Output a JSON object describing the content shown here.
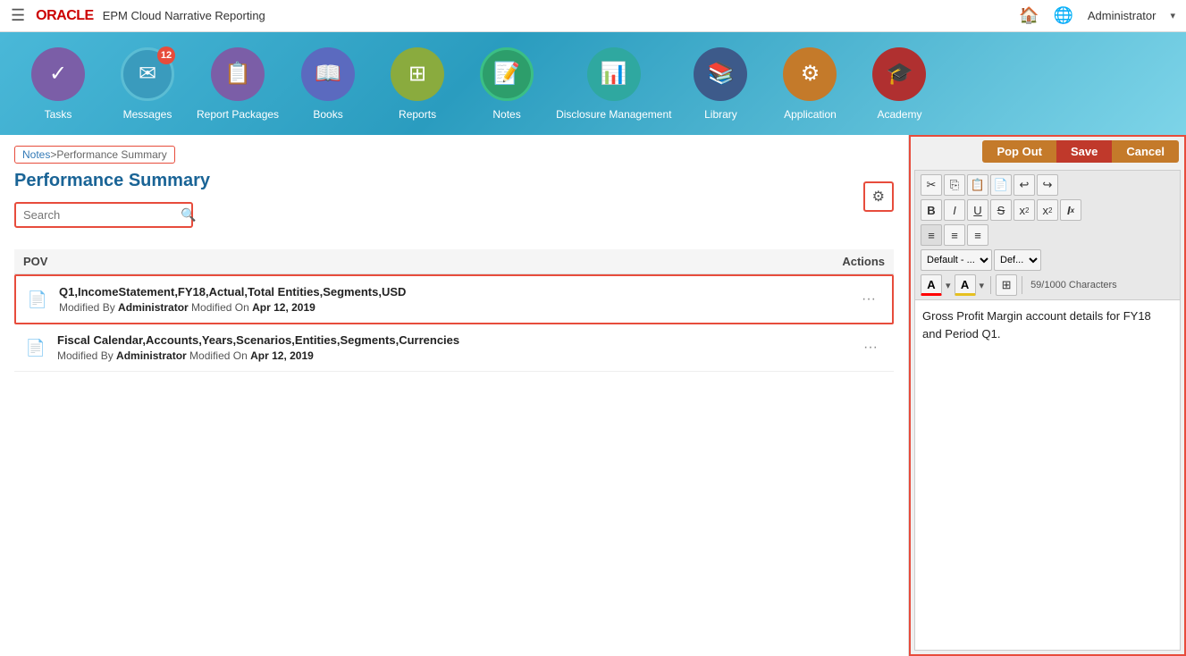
{
  "app": {
    "title": "EPM Cloud Narrative Reporting",
    "user": "Administrator"
  },
  "nav": {
    "items": [
      {
        "id": "tasks",
        "label": "Tasks",
        "icon": "✓",
        "circle": "circle-purple",
        "badge": null
      },
      {
        "id": "messages",
        "label": "Messages",
        "icon": "✉",
        "circle": "circle-teal",
        "badge": "12"
      },
      {
        "id": "report-packages",
        "label": "Report Packages",
        "icon": "📋",
        "circle": "circle-purple2",
        "badge": null
      },
      {
        "id": "books",
        "label": "Books",
        "icon": "📖",
        "circle": "circle-indigo",
        "badge": null
      },
      {
        "id": "reports",
        "label": "Reports",
        "icon": "⊞",
        "circle": "circle-olive",
        "badge": null
      },
      {
        "id": "notes",
        "label": "Notes",
        "icon": "📝",
        "circle": "circle-green",
        "badge": null
      },
      {
        "id": "disclosure",
        "label": "Disclosure Management",
        "icon": "📊",
        "circle": "circle-teal2",
        "badge": null
      },
      {
        "id": "library",
        "label": "Library",
        "icon": "📚",
        "circle": "circle-navy",
        "badge": null
      },
      {
        "id": "application",
        "label": "Application",
        "icon": "⚙",
        "circle": "circle-brown",
        "badge": null
      },
      {
        "id": "academy",
        "label": "Academy",
        "icon": "🎓",
        "circle": "circle-red",
        "badge": null
      }
    ]
  },
  "breadcrumb": {
    "parent": "Notes",
    "separator": " > ",
    "current": "Performance Summary"
  },
  "page": {
    "title": "Performance Summary"
  },
  "search": {
    "placeholder": "Search"
  },
  "table": {
    "col_pov": "POV",
    "col_actions": "Actions"
  },
  "notes": [
    {
      "id": 1,
      "selected": true,
      "title": "Q1,IncomeStatement,FY18,Actual,Total Entities,Segments,USD",
      "modified_by_label": "Modified By",
      "modified_by": "Administrator",
      "modified_on_label": "Modified On",
      "modified_on": "Apr 12, 2019"
    },
    {
      "id": 2,
      "selected": false,
      "title": "Fiscal Calendar,Accounts,Years,Scenarios,Entities,Segments,Currencies",
      "modified_by_label": "Modified By",
      "modified_by": "Administrator",
      "modified_on_label": "Modified On",
      "modified_on": "Apr 12, 2019"
    }
  ],
  "editor": {
    "popout_label": "Pop Out",
    "save_label": "Save",
    "cancel_label": "Cancel",
    "char_count": "59/1000 Characters",
    "content": "Gross Profit Margin account details for FY18 and Period Q1.",
    "font_family": "Default - ...",
    "font_size": "Def..."
  }
}
